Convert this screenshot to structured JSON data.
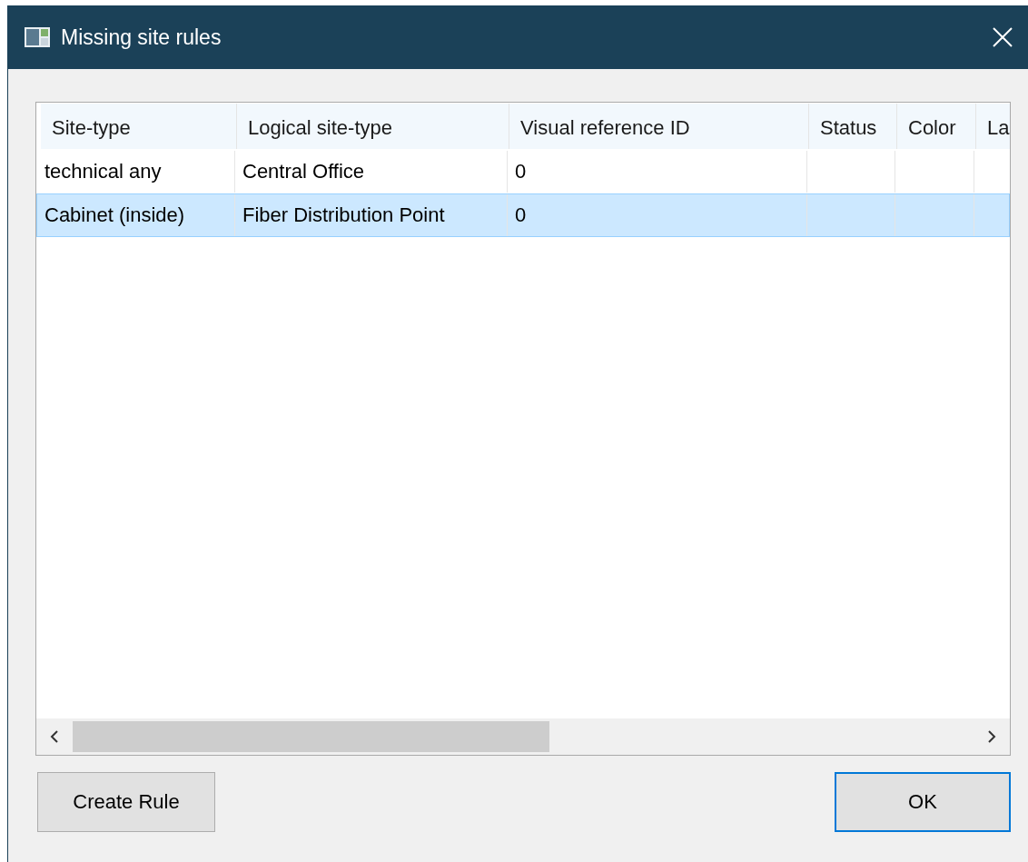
{
  "window": {
    "title": "Missing site rules"
  },
  "table": {
    "columns": [
      "Site-type",
      "Logical site-type",
      "Visual reference ID",
      "Status",
      "Color",
      "La"
    ],
    "rows": [
      {
        "cells": [
          "technical any",
          "Central Office",
          "0"
        ],
        "selected": false
      },
      {
        "cells": [
          "Cabinet (inside)",
          "Fiber Distribution Point",
          "0"
        ],
        "selected": true
      }
    ]
  },
  "buttons": [
    {
      "label": "Create Rule",
      "default": false
    },
    {
      "label": "OK",
      "default": true
    }
  ]
}
